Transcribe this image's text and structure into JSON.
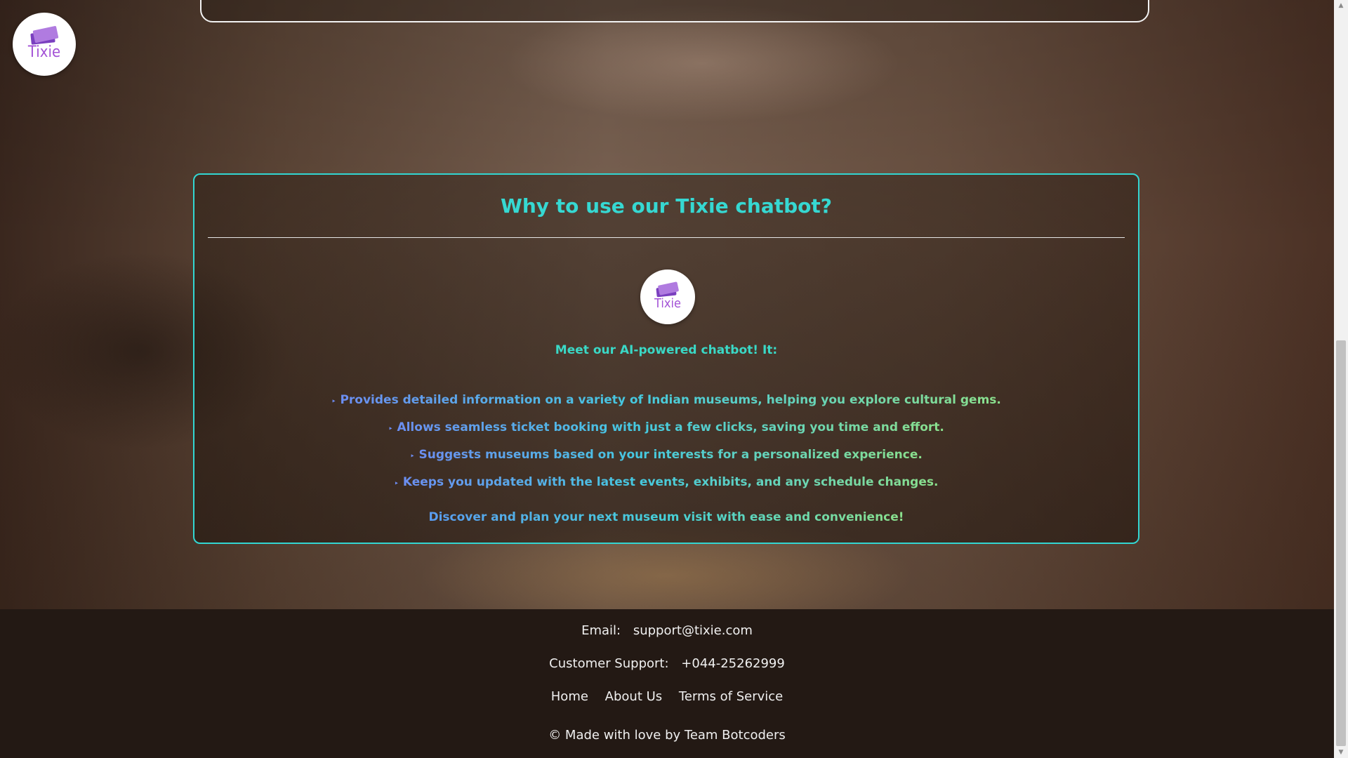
{
  "logo": {
    "text": "Tixie"
  },
  "why_card": {
    "title": "Why to use our Tixie chatbot?",
    "logo_text": "Tixie",
    "intro": "Meet our AI-powered chatbot! It:",
    "bullet": "‣",
    "features": [
      "Provides detailed information on a variety of Indian museums, helping you explore cultural gems.",
      "Allows seamless ticket booking with just a few clicks, saving you time and effort.",
      "Suggests museums based on your interests for a personalized experience.",
      "Keeps you updated with the latest events, exhibits, and any schedule changes."
    ],
    "closing": "Discover and plan your next museum visit with ease and convenience!"
  },
  "footer": {
    "email_label": "Email:",
    "email_value": "support@tixie.com",
    "support_label": "Customer Support:",
    "support_value": "+044-25262999",
    "links": [
      "Home",
      "About Us",
      "Terms of Service"
    ],
    "copyright": "© Made with love by Team Botcoders"
  },
  "colors": {
    "accent_teal": "#32d6d2",
    "brand_purple": "#a352d6",
    "footer_bg": "#231914"
  }
}
